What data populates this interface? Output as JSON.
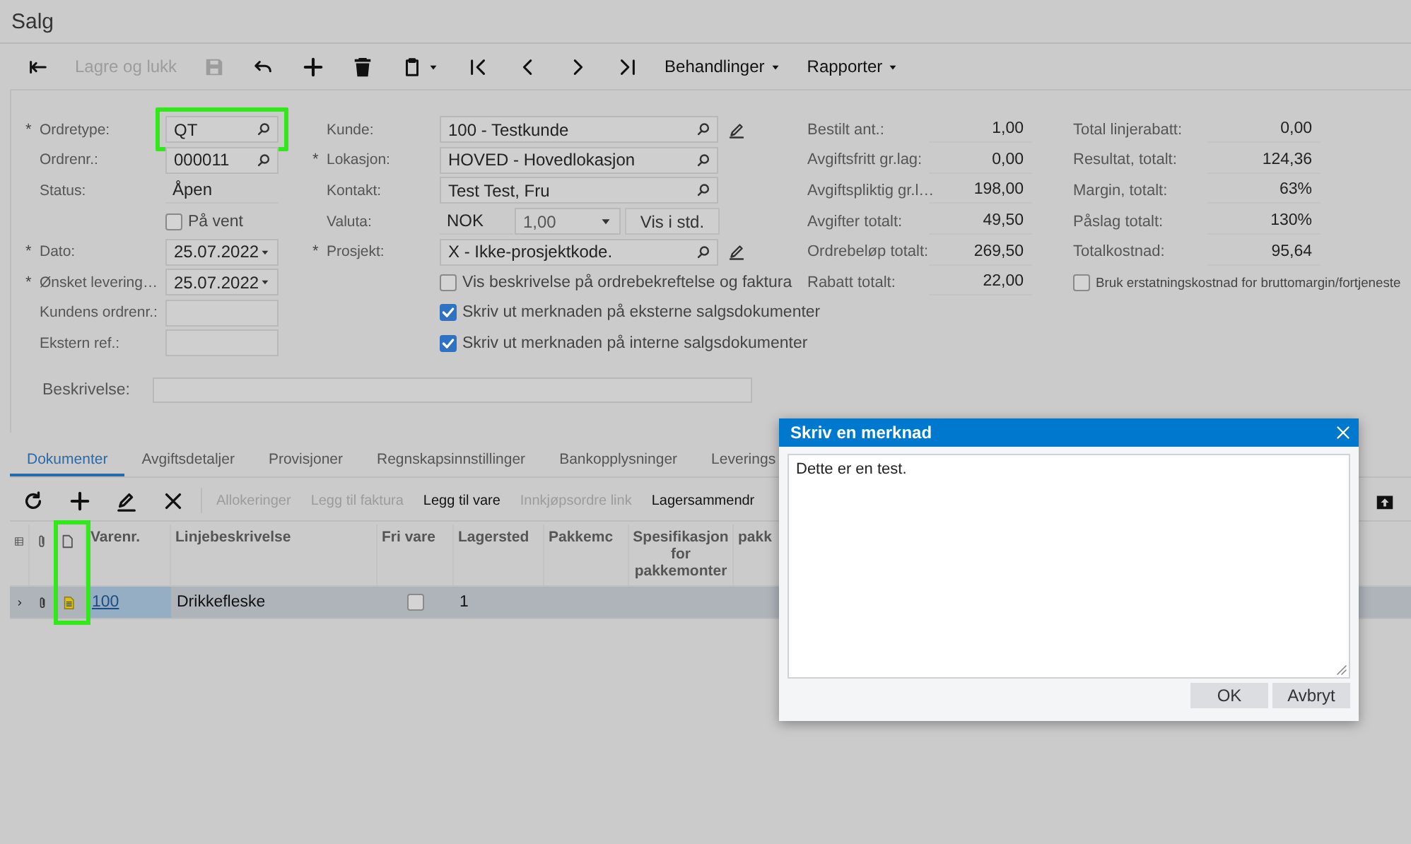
{
  "title": "Salg",
  "toolbar": [
    {
      "kind": "back",
      "disabled": false
    },
    {
      "kind": "text",
      "label": "Lagre og lukk",
      "disabled": true
    },
    {
      "kind": "save",
      "disabled": true
    },
    {
      "kind": "undo",
      "disabled": false
    },
    {
      "kind": "add",
      "disabled": false
    },
    {
      "kind": "delete",
      "disabled": false
    },
    {
      "kind": "clipboard",
      "disabled": false
    },
    {
      "kind": "first",
      "disabled": false
    },
    {
      "kind": "prev",
      "disabled": false
    },
    {
      "kind": "next",
      "disabled": false
    },
    {
      "kind": "last",
      "disabled": false
    },
    {
      "kind": "menu",
      "label": "Behandlinger",
      "disabled": false
    },
    {
      "kind": "menu",
      "label": "Rapporter",
      "disabled": false
    }
  ],
  "form": {
    "col1": [
      {
        "kind": "lookup",
        "required_mark": "*",
        "label": "Ordretype:",
        "value": "QT",
        "highlighted": true
      },
      {
        "kind": "lookup",
        "label": "Ordrenr.:",
        "value": "000011",
        "highlighted": false
      },
      {
        "kind": "static",
        "label": "Status:",
        "value": "Åpen",
        "highlighted": false
      },
      {
        "kind": "checkbox",
        "label": "På vent",
        "checked": false
      },
      {
        "kind": "date",
        "required_mark": "*",
        "label": "Dato:",
        "value": "25.07.2022",
        "highlighted": false
      },
      {
        "kind": "date",
        "required_mark": "*",
        "label": "Ønsket levering…",
        "value": "25.07.2022",
        "highlighted": false
      },
      {
        "kind": "text",
        "label": "Kundens ordrenr.:",
        "highlighted": false
      },
      {
        "kind": "text",
        "label": "Ekstern ref.:",
        "highlighted": false
      }
    ],
    "col2": [
      {
        "kind": "lookup",
        "label": "Kunde:",
        "value": "100 - Testkunde",
        "editable": true
      },
      {
        "kind": "lookup",
        "required_mark": "*",
        "label": "Lokasjon:",
        "value": "HOVED - Hovedlokasjon",
        "editable": false
      },
      {
        "kind": "lookup",
        "label": "Kontakt:",
        "value": "Test Test, Fru",
        "editable": false
      },
      {
        "kind": "currency",
        "label": "Valuta:",
        "value": "NOK",
        "rate": "1,00",
        "button": "Vis i std."
      },
      {
        "kind": "lookup",
        "required_mark": "*",
        "label": "Prosjekt:",
        "value": "X - Ikke-prosjektkode.",
        "editable": true
      },
      {
        "kind": "checkbox",
        "label": "Vis beskrivelse på ordrebekreftelse og faktura",
        "checked": false
      },
      {
        "kind": "checkbox",
        "label": "Skriv ut merknaden på eksterne salgsdokumenter",
        "checked": true
      },
      {
        "kind": "checkbox",
        "label": "Skriv ut merknaden på interne salgsdokumenter",
        "checked": true
      }
    ],
    "col3": [
      {
        "kind": "total",
        "label": "Bestilt ant.:",
        "value": "1,00"
      },
      {
        "kind": "total",
        "label": "Avgiftsfritt gr.lag:",
        "value": "0,00"
      },
      {
        "kind": "total",
        "label": "Avgiftspliktig gr.l…",
        "value": "198,00"
      },
      {
        "kind": "total",
        "label": "Avgifter totalt:",
        "value": "49,50"
      },
      {
        "kind": "total",
        "label": "Ordrebeløp totalt:",
        "value": "269,50"
      },
      {
        "kind": "total",
        "label": "Rabatt totalt:",
        "value": "22,00"
      }
    ],
    "col4": [
      {
        "kind": "total",
        "label": "Total linjerabatt:",
        "value": "0,00"
      },
      {
        "kind": "total",
        "label": "Resultat, totalt:",
        "value": "124,36"
      },
      {
        "kind": "total",
        "label": "Margin, totalt:",
        "value": "63%"
      },
      {
        "kind": "total",
        "label": "Påslag totalt:",
        "value": "130%"
      },
      {
        "kind": "total",
        "label": "Totalkostnad:",
        "value": "95,64"
      },
      {
        "kind": "checkbox",
        "label": "Bruk erstatningskostnad for bruttomargin/fortjeneste",
        "checked": false
      }
    ],
    "description": {
      "label": "Beskrivelse:"
    }
  },
  "tabs": [
    {
      "label": "Dokumenter",
      "selected": true
    },
    {
      "label": "Avgiftsdetaljer",
      "selected": false
    },
    {
      "label": "Provisjoner",
      "selected": false
    },
    {
      "label": "Regnskapsinnstillinger",
      "selected": false
    },
    {
      "label": "Bankopplysninger",
      "selected": false
    },
    {
      "label": "Leverings",
      "selected": false
    }
  ],
  "grid_toolbar": [
    {
      "kind": "refresh",
      "disabled": false
    },
    {
      "kind": "add",
      "disabled": false
    },
    {
      "kind": "edit",
      "disabled": false
    },
    {
      "kind": "remove",
      "disabled": false
    },
    {
      "kind": "separator"
    },
    {
      "kind": "text",
      "label": "Allokeringer",
      "disabled": true
    },
    {
      "kind": "text",
      "label": "Legg til faktura",
      "disabled": true
    },
    {
      "kind": "text",
      "label": "Legg til vare",
      "disabled": false
    },
    {
      "kind": "text",
      "label": "Innkjøpsordre link",
      "disabled": true
    },
    {
      "kind": "text",
      "label": "Lagersammendr",
      "disabled": false
    },
    {
      "kind": "upload",
      "disabled": false
    }
  ],
  "table": {
    "columns": [
      {
        "kind": "settings"
      },
      {
        "kind": "attachments"
      },
      {
        "kind": "notes",
        "highlighted": true
      },
      {
        "kind": "text",
        "label": "Varenr."
      },
      {
        "kind": "text",
        "label": "Linjebeskrivelse"
      },
      {
        "kind": "text",
        "label": "Fri vare"
      },
      {
        "kind": "text",
        "label": "Lagersted"
      },
      {
        "kind": "text",
        "label": "Pakkemc"
      },
      {
        "kind": "text",
        "label": "Spesifikasjon for pakkemonter"
      },
      {
        "kind": "text",
        "label": "pakk"
      }
    ],
    "rows": [
      {
        "selected": true,
        "has_note": true,
        "varenr": "100",
        "beskrivelse": "Drikkefleske",
        "fri_vare": false,
        "lagersted": "1"
      }
    ]
  },
  "dialog": {
    "title": "Skriv en merknad",
    "text": "Dette er en test.",
    "buttons": [
      "OK",
      "Avbryt"
    ]
  }
}
